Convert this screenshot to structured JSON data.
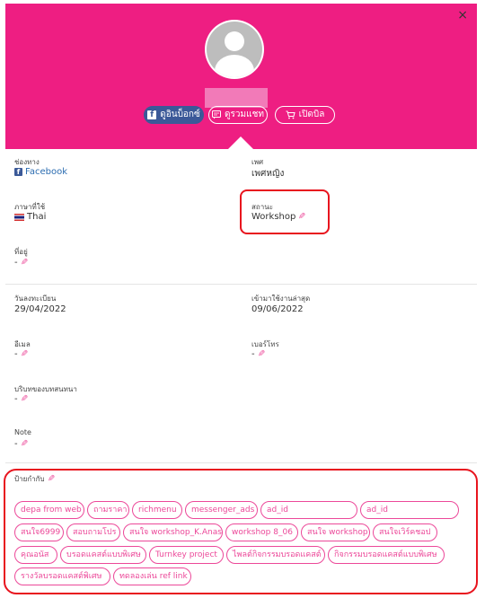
{
  "header": {
    "close_label": "×",
    "buttons": {
      "facebook_inbox": "ดูอินบ็อกซ์",
      "view_chat": "ดูรวมแชท",
      "open_bill": "เปิดบิล"
    }
  },
  "fields": {
    "channel": {
      "label": "ช่องทาง",
      "value": "Facebook"
    },
    "gender": {
      "label": "เพศ",
      "value": "เพศหญิง"
    },
    "language": {
      "label": "ภาษาที่ใช้",
      "value": "Thai"
    },
    "status": {
      "label": "สถานะ",
      "value": "Workshop"
    },
    "address": {
      "label": "ที่อยู่",
      "value": "-"
    },
    "registered": {
      "label": "วันลงทะเบียน",
      "value": "29/04/2022"
    },
    "last_seen": {
      "label": "เข้ามาใช้งานล่าสุด",
      "value": "09/06/2022"
    },
    "email": {
      "label": "อีเมล",
      "value": "-"
    },
    "phone": {
      "label": "เบอร์โทร",
      "value": "-"
    },
    "context": {
      "label": "บริบทของบทสนทนา",
      "value": "-"
    },
    "note": {
      "label": "Note",
      "value": "-"
    }
  },
  "tags_label": "ป้ายกำกับ",
  "tags": [
    "depa from web",
    "ถามราคา",
    "richmenu",
    "messenger_ads",
    "ad_id",
    "ad_id",
    "สนใจ6999",
    "สอบถามโปร",
    "สนใจ workshop_K.Anas",
    "workshop 8_06",
    "สนใจ workshop",
    "สนใจเวิร์คชอป",
    "คุณอนัส",
    "บรอดแคสต์แบบพิเศษ",
    "Turnkey project",
    "ไพลต์กิจกรรมบรอดแคสต์",
    "กิจกรรมบรอดแคสต์แบบพิเศษ",
    "รางวัลบรอดแคสต์พิเศษ",
    "ทดลองเล่น ref link"
  ],
  "colors": {
    "header_bg": "#ee1e82",
    "accent_pink": "#ec4899",
    "facebook_blue": "#3b5998",
    "highlight_red": "#e8141e"
  },
  "icons": [
    "close-icon",
    "facebook-icon",
    "chat-icon",
    "cart-icon",
    "pencil-icon",
    "thai-flag-icon",
    "avatar-placeholder-icon"
  ]
}
